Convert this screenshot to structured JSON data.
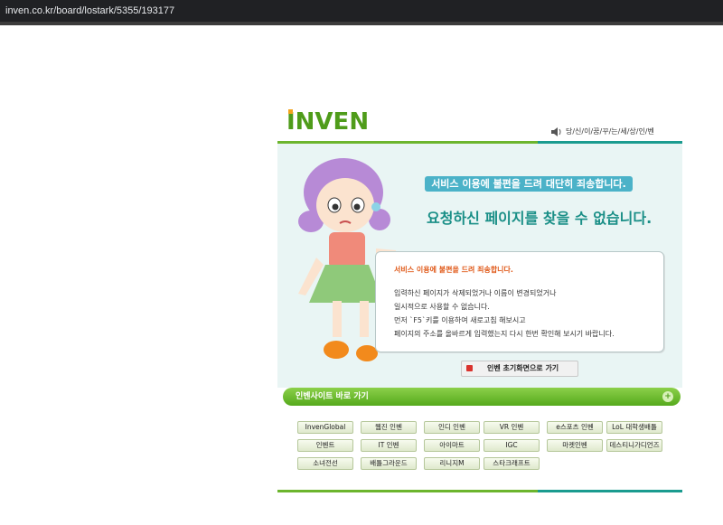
{
  "browser": {
    "url": "inven.co.kr/board/lostark/5355/193177"
  },
  "header": {
    "logo_text": "INVEN",
    "slogan": "당/신/이/꿈/꾸/는/세/상/인/벤"
  },
  "error": {
    "apology_banner": "서비스 이용에 불편을 드려 대단히 죄송합니다.",
    "not_found_title": "요청하신 페이지를 찾을 수 없습니다.",
    "bubble_title": "서비스 이용에 불편을 드려 죄송합니다.",
    "lines": [
      "입력하신 페이지가 삭제되었거나 이름이 변경되었거나",
      "일시적으로 사용할 수 없습니다.",
      "먼저 `F5`키를 이용하여 새로고침 해보시고",
      "페이지의 주소를 올바르게 입력했는지 다시 한번 확인해 보시기 바랍니다."
    ]
  },
  "home_button": {
    "label": "인벤 초기화면으로 가기"
  },
  "quick_links": {
    "title": "인벤사이트 바로 가기",
    "sites": [
      "InvenGlobal",
      "웹진 인벤",
      "인디 인벤",
      "VR 인벤",
      "e스포츠 인벤",
      "LoL 대학생배틀",
      "인벤트",
      "IT 인벤",
      "아이마트",
      "IGC",
      "마켓인벤",
      "데스티니가디언즈",
      "소녀전선",
      "배틀그라운드",
      "리니지M",
      "스타크래프트"
    ]
  },
  "colors": {
    "brand_green": "#4f9c1a",
    "teal": "#1a8f87",
    "banner_blue": "#4bb2c8",
    "alert_orange": "#e05a1a"
  }
}
